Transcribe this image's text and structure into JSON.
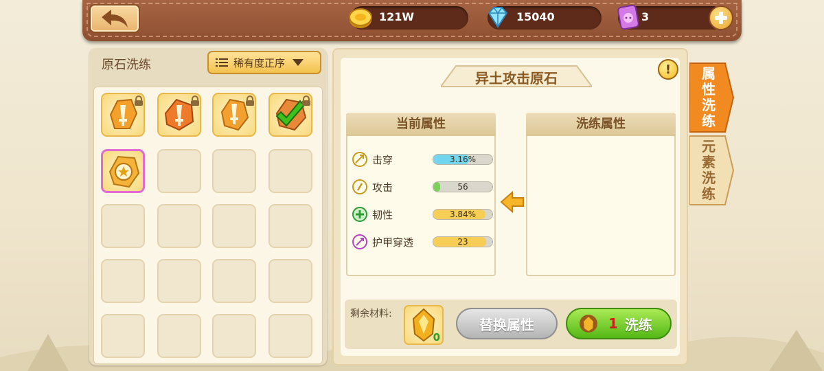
{
  "header": {
    "gold_value": "121W",
    "diamond_value": "15040",
    "ticket_value": "3",
    "icons": [
      "back-arrow-icon",
      "gold-coin-icon",
      "diamond-icon",
      "pig-ticket-icon",
      "plus-icon"
    ]
  },
  "left_panel": {
    "title": "原石洗练",
    "sort_label": "稀有度正序",
    "filled_slots": 5,
    "total_slots": 20
  },
  "right_panel": {
    "title": "异土攻击原石",
    "current_header": "当前属性",
    "refine_header": "洗练属性",
    "current_attributes": [
      {
        "name": "击穿",
        "value": "3.16%",
        "fill": 0.62,
        "color": "#73d6ee",
        "icon": "pierce-icon"
      },
      {
        "name": "攻击",
        "value": "56",
        "fill": 0.12,
        "color": "#7ad25a",
        "icon": "attack-icon"
      },
      {
        "name": "韧性",
        "value": "3.84%",
        "fill": 0.88,
        "color": "#f6ce55",
        "icon": "toughness-icon"
      },
      {
        "name": "护甲穿透",
        "value": "23",
        "fill": 0.9,
        "color": "#f6ce55",
        "icon": "armor-pen-icon"
      }
    ],
    "remaining_label": "剩余材料:",
    "material_count": "0",
    "replace_button": "替换属性",
    "refine_count": "1",
    "refine_button": "洗练"
  },
  "side_tabs": [
    {
      "label": "属性洗练",
      "active": true
    },
    {
      "label": "元素洗练",
      "active": false
    }
  ],
  "colors": {
    "accent_orange": "#f28a22",
    "panel_brown": "#9a5a3a",
    "refine_green": "#6cc520"
  }
}
